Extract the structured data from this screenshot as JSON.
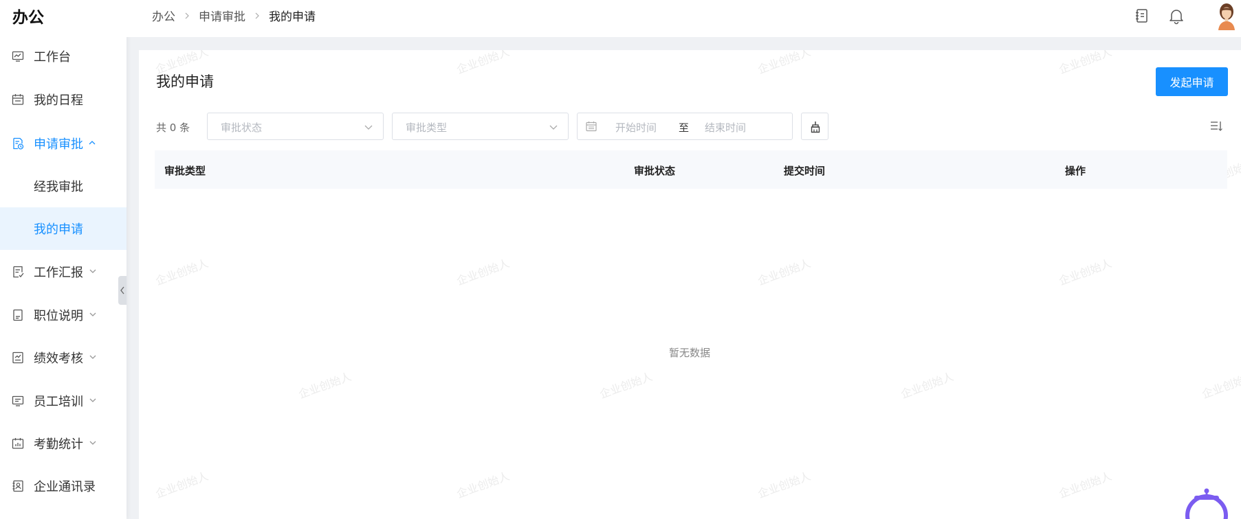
{
  "app": {
    "title": "办公"
  },
  "sidebar": {
    "items": [
      {
        "label": "工作台",
        "icon": "dashboard-icon"
      },
      {
        "label": "我的日程",
        "icon": "calendar-icon"
      },
      {
        "label": "申请审批",
        "icon": "approval-doc-icon",
        "expanded": true,
        "children": [
          {
            "label": "经我审批"
          },
          {
            "label": "我的申请"
          }
        ]
      },
      {
        "label": "工作汇报",
        "icon": "report-icon"
      },
      {
        "label": "职位说明",
        "icon": "document-icon"
      },
      {
        "label": "绩效考核",
        "icon": "performance-icon"
      },
      {
        "label": "员工培训",
        "icon": "training-icon"
      },
      {
        "label": "考勤统计",
        "icon": "attendance-icon"
      },
      {
        "label": "企业通讯录",
        "icon": "contacts-icon"
      }
    ]
  },
  "breadcrumb": [
    "办公",
    "申请审批",
    "我的申请"
  ],
  "header": {
    "icons": [
      "notebook-icon",
      "bell-icon",
      "avatar"
    ]
  },
  "main": {
    "title": "我的申请",
    "primary_button": "发起申请",
    "total": "共 0 条",
    "filters": {
      "status_placeholder": "审批状态",
      "type_placeholder": "审批类型",
      "start_placeholder": "开始时间",
      "range_separator": "至",
      "end_placeholder": "结束时间"
    },
    "table": {
      "columns": [
        "审批类型",
        "审批状态",
        "提交时间",
        "操作"
      ],
      "rows": [],
      "empty_text": "暂无数据"
    },
    "watermark": "企业创始人"
  },
  "colors": {
    "accent": "#1890ff",
    "active_bg": "#eaf4fe"
  }
}
